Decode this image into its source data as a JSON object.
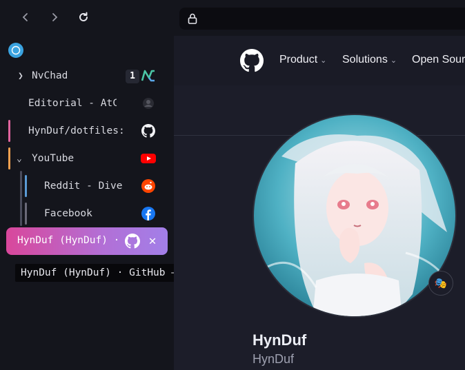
{
  "toolbar": {
    "back_icon": "chevron-left-icon",
    "forward_icon": "chevron-right-icon",
    "reload_icon": "reload-icon",
    "lock_icon": "lock-icon",
    "url": ""
  },
  "sidebar": {
    "workspace_icon": "zen-workspace-icon",
    "tabs": [
      {
        "title": "NvChad",
        "favicon": "nvchad-icon",
        "badge": "1",
        "chevron": ">"
      },
      {
        "title": "Editorial - AtCoder",
        "favicon": "atcoder-icon"
      },
      {
        "title": "HynDuf/dotfiles: ",
        "favicon": "github-icon",
        "accent": "#e0649e"
      },
      {
        "title": "YouTube",
        "favicon": "youtube-icon",
        "chevron": "v",
        "accent": "#f0a050"
      },
      {
        "title": "Reddit - Dive into anything",
        "favicon": "reddit-icon",
        "accent": "#5b9bd5"
      },
      {
        "title": "Facebook",
        "favicon": "facebook-icon",
        "accent": "#6a6a78"
      }
    ],
    "active_tab": {
      "title": "HynDuf (HynDuf) · GitHub",
      "favicon": "github-icon",
      "close": "✕"
    },
    "tooltip": "HynDuf (HynDuf) · GitHub — Personal"
  },
  "page": {
    "logo": "github-logo-icon",
    "menu": [
      "Product",
      "Solutions",
      "Open Source"
    ],
    "profile": {
      "display_name": "HynDuf",
      "username": "HynDuf",
      "status_emoji": "🎭"
    }
  },
  "colors": {
    "active_tab_start": "#d9479b",
    "active_tab_end": "#a27fe8",
    "background": "#14151c",
    "content": "#1c1d29"
  }
}
